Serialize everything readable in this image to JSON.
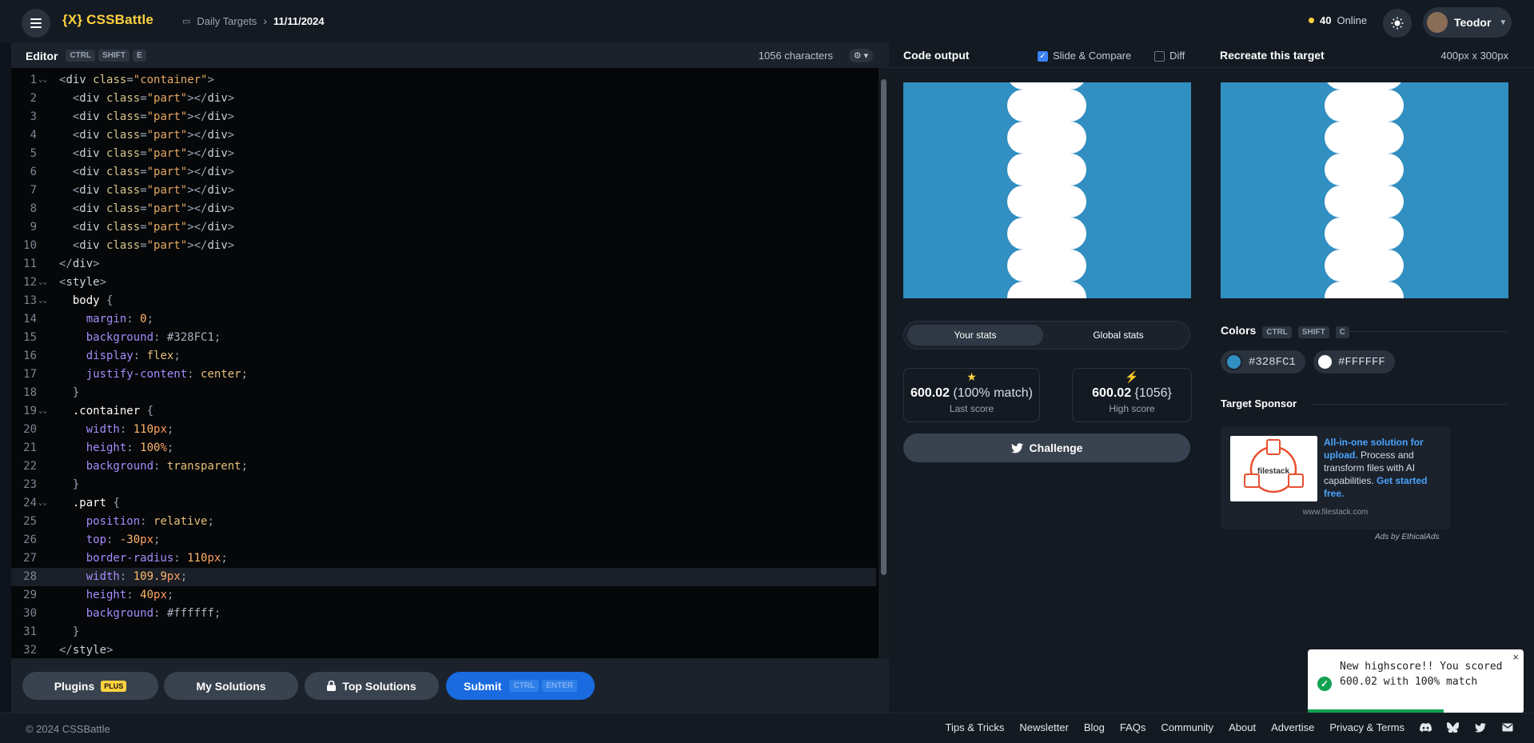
{
  "topbar": {
    "logo": "{X} CSSBattle",
    "crumb_section": "Daily Targets",
    "crumb_date": "11/11/2024",
    "online_count": "40",
    "online_label": "Online",
    "user_name": "Teodor"
  },
  "editor": {
    "title": "Editor",
    "shortcut": [
      "CTRL",
      "SHIFT",
      "E"
    ],
    "char_count": "1056 characters",
    "lines": [
      "<div class=\"container\">",
      "  <div class=\"part\"></div>",
      "  <div class=\"part\"></div>",
      "  <div class=\"part\"></div>",
      "  <div class=\"part\"></div>",
      "  <div class=\"part\"></div>",
      "  <div class=\"part\"></div>",
      "  <div class=\"part\"></div>",
      "  <div class=\"part\"></div>",
      "  <div class=\"part\"></div>",
      "</div>",
      "<style>",
      "  body {",
      "    margin: 0;",
      "    background: #328FC1;",
      "    display: flex;",
      "    justify-content: center;",
      "  }",
      "  .container {",
      "    width: 110px;",
      "    height: 100%;",
      "    background: transparent;",
      "  }",
      "  .part {",
      "    position: relative;",
      "    top: -30px;",
      "    border-radius: 110px;",
      "    width: 109.9px;",
      "    height: 40px;",
      "    background: #ffffff;",
      "  }",
      "</style>"
    ],
    "highlight_line": 28
  },
  "bottombar": {
    "plugins": "Plugins",
    "plus": "PLUS",
    "my_solutions": "My Solutions",
    "top_solutions": "Top Solutions",
    "submit": "Submit",
    "submit_keys": [
      "CTRL",
      "ENTER"
    ]
  },
  "output": {
    "title": "Code output",
    "slide_compare": "Slide & Compare",
    "slide_checked": true,
    "diff": "Diff",
    "diff_checked": false
  },
  "stats": {
    "tab_yours": "Your stats",
    "tab_global": "Global stats",
    "last_score": "600.02",
    "last_match": "(100% match)",
    "last_label": "Last score",
    "high_score": "600.02",
    "high_chars": "{1056}",
    "high_label": "High score",
    "challenge": "Challenge"
  },
  "target": {
    "title": "Recreate this target",
    "dims": "400px x 300px",
    "colors_title": "Colors",
    "colors_keys": [
      "CTRL",
      "SHIFT",
      "C"
    ],
    "colors": [
      {
        "hex": "#328FC1",
        "label": "#328FC1"
      },
      {
        "hex": "#FFFFFF",
        "label": "#FFFFFF"
      }
    ],
    "sponsor_title": "Target Sponsor",
    "ad_brand": "filestack",
    "ad_link1": "All-in-one solution for upload.",
    "ad_body": " Process and transform files with AI capabilities. ",
    "ad_link2": "Get started free.",
    "ad_url": "www.filestack.com",
    "ads_by": "Ads by EthicalAds"
  },
  "toast": {
    "message": "New highscore!! You scored 600.02 with 100% match",
    "close": "×"
  },
  "footer": {
    "copyright": "© 2024 CSSBattle",
    "links": [
      "Tips & Tricks",
      "Newsletter",
      "Blog",
      "FAQs",
      "Community",
      "About",
      "Advertise",
      "Privacy & Terms"
    ]
  },
  "colors": {
    "accent": "#FFD23F",
    "target_bg": "#328FC1",
    "target_fg": "#FFFFFF",
    "submit": "#1A6BE0"
  }
}
